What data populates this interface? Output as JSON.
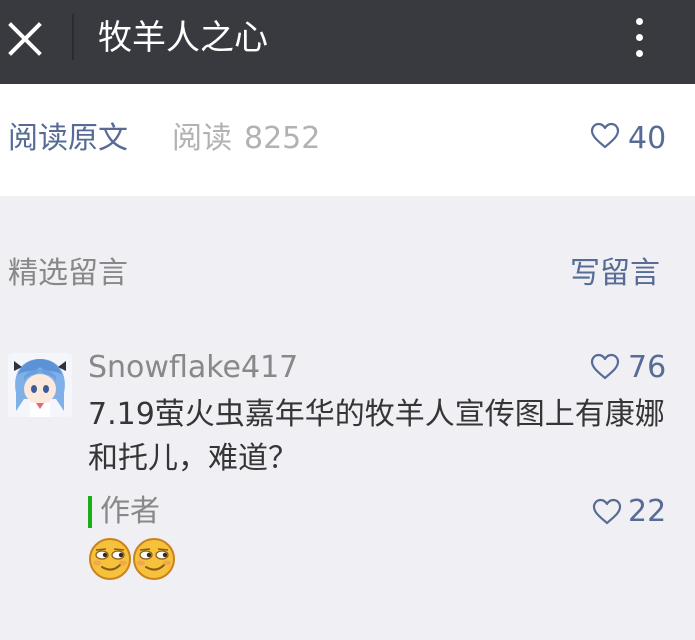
{
  "header": {
    "title": "牧羊人之心",
    "close_icon": "close-icon",
    "more_icon": "more-vertical-icon"
  },
  "stats": {
    "read_original": "阅读原文",
    "read_label": "阅读",
    "read_count": "8252",
    "like_count": "40",
    "like_icon": "heart-outline-icon"
  },
  "comments_section": {
    "title": "精选留言",
    "write_label": "写留言"
  },
  "comments": [
    {
      "username": "Snowflake417",
      "likes": "76",
      "text": "7.19萤火虫嘉年华的牧羊人宣传图上有康娜和托儿，难道？",
      "reply": {
        "author_label": "作者",
        "likes": "22",
        "emojis": [
          "smirk-emoji",
          "smirk-emoji"
        ]
      }
    }
  ],
  "colors": {
    "header_bg": "#393a3f",
    "link_blue": "#576b95",
    "author_green": "#1aad19",
    "page_bg": "#efeff4"
  }
}
